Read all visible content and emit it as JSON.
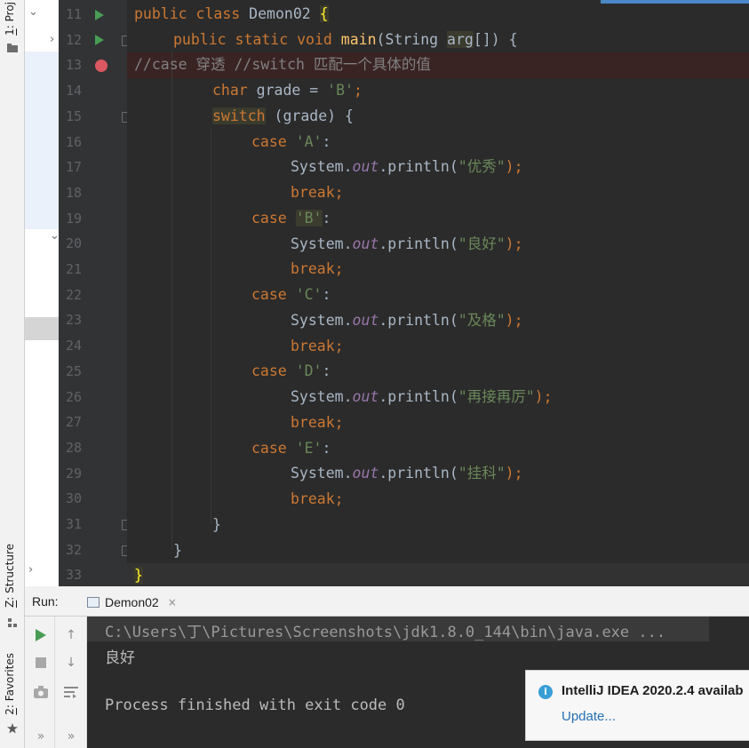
{
  "tool_windows": {
    "project": {
      "number": "1",
      "label": "Proj"
    },
    "structure": {
      "number": "Z",
      "label": "Structure"
    },
    "favorites": {
      "number": "2",
      "label": "Favorites"
    }
  },
  "editor": {
    "line_numbers": [
      "11",
      "12",
      "13",
      "14",
      "15",
      "16",
      "17",
      "18",
      "19",
      "20",
      "21",
      "22",
      "23",
      "24",
      "25",
      "26",
      "27",
      "28",
      "29",
      "30",
      "31",
      "32",
      "33"
    ],
    "breakpoint_line": "13",
    "run_gutter_lines": [
      "11",
      "12"
    ],
    "code": {
      "l11": {
        "kw1": "public",
        "kw2": "class",
        "name": "Demon02",
        "brace": "{"
      },
      "l12": {
        "kw1": "public",
        "kw2": "static",
        "kw3": "void",
        "fn": "main",
        "pre": "(String ",
        "arg": "arg",
        "post": "[]) {"
      },
      "l13": {
        "comment": "//case 穿透 //switch 匹配一个具体的值"
      },
      "l14": {
        "kw": "char",
        "mid": " grade = ",
        "str": "'B'",
        "end": ";"
      },
      "l15": {
        "kw": "switch",
        "rest": " (grade) {"
      },
      "cases": [
        {
          "kw": "case",
          "label": "'A'",
          "out_pre": "System.",
          "out": "out",
          "out_post": ".println(",
          "text": "\"优秀\"",
          "close": ");",
          "brk": "break;"
        },
        {
          "kw": "case",
          "label": "'B'",
          "out_pre": "System.",
          "out": "out",
          "out_post": ".println(",
          "text": "\"良好\"",
          "close": ");",
          "brk": "break;"
        },
        {
          "kw": "case",
          "label": "'C'",
          "out_pre": "System.",
          "out": "out",
          "out_post": ".println(",
          "text": "\"及格\"",
          "close": ");",
          "brk": "break;"
        },
        {
          "kw": "case",
          "label": "'D'",
          "out_pre": "System.",
          "out": "out",
          "out_post": ".println(",
          "text": "\"再接再厉\"",
          "close": ");",
          "brk": "break;"
        },
        {
          "kw": "case",
          "label": "'E'",
          "out_pre": "System.",
          "out": "out",
          "out_post": ".println(",
          "text": "\"挂科\"",
          "close": ");",
          "brk": "break;"
        }
      ],
      "l31": "}",
      "l32": "}",
      "l33": "}"
    }
  },
  "run_panel": {
    "label": "Run:",
    "tab_label": "Demon02",
    "tab_close": "×",
    "console": {
      "command": "C:\\Users\\丁\\Pictures\\Screenshots\\jdk1.8.0_144\\bin\\java.exe ...",
      "output": "良好",
      "exit": "Process finished with exit code 0"
    }
  },
  "notification": {
    "title": "IntelliJ IDEA 2020.2.4 availab",
    "link": "Update..."
  }
}
